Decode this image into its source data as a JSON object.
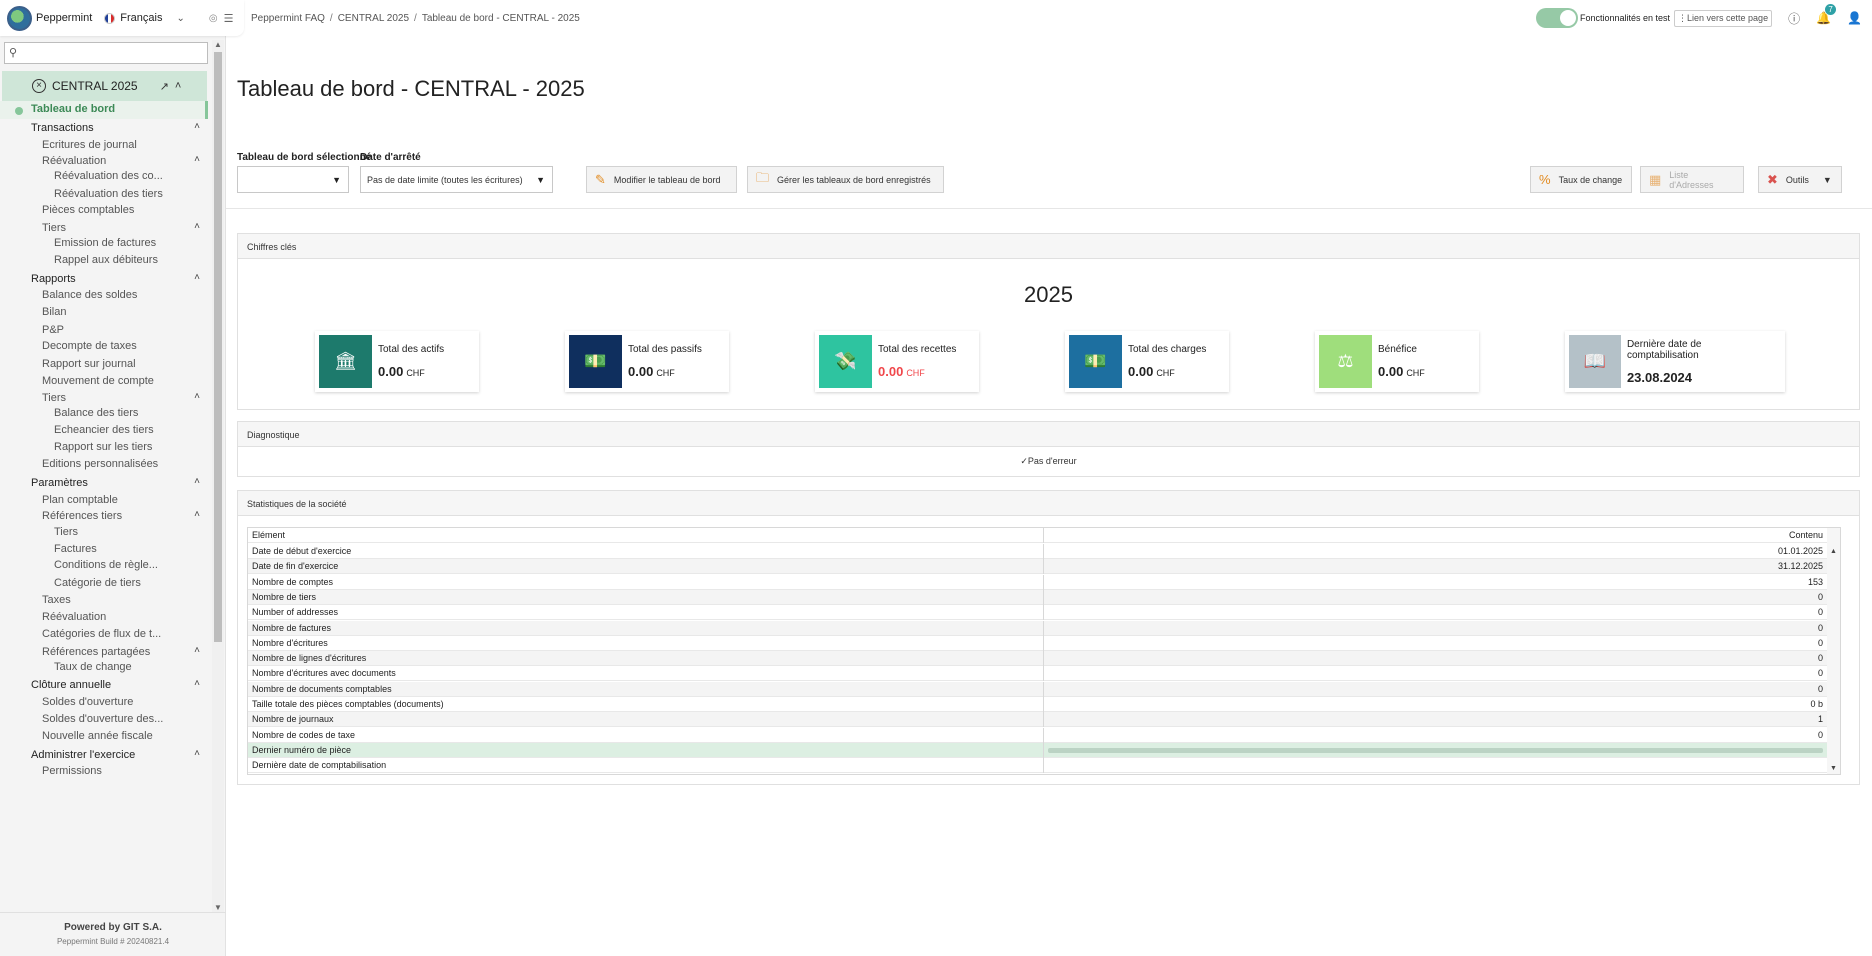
{
  "app": {
    "name": "Peppermint",
    "language": "Français"
  },
  "search": {
    "placeholder": ""
  },
  "company": {
    "label": "CENTRAL 2025"
  },
  "nav": [
    {
      "label": "Tableau de bord",
      "level": 1,
      "active": true
    },
    {
      "label": "Transactions",
      "level": 1,
      "section": true,
      "caret": "up"
    },
    {
      "label": "Ecritures de journal",
      "level": 2
    },
    {
      "label": "Réévaluation",
      "level": 2,
      "caret": "up"
    },
    {
      "label": "Réévaluation des co...",
      "level": 3
    },
    {
      "label": "Réévaluation des tiers",
      "level": 3
    },
    {
      "label": "Pièces comptables",
      "level": 2
    },
    {
      "label": "Tiers",
      "level": 2,
      "caret": "up"
    },
    {
      "label": "Emission de factures",
      "level": 3
    },
    {
      "label": "Rappel aux débiteurs",
      "level": 3
    },
    {
      "label": "Rapports",
      "level": 1,
      "section": true,
      "caret": "up"
    },
    {
      "label": "Balance des soldes",
      "level": 2
    },
    {
      "label": "Bilan",
      "level": 2
    },
    {
      "label": "P&P",
      "level": 2
    },
    {
      "label": "Decompte de taxes",
      "level": 2
    },
    {
      "label": "Rapport sur journal",
      "level": 2
    },
    {
      "label": "Mouvement de compte",
      "level": 2
    },
    {
      "label": "Tiers",
      "level": 2,
      "caret": "up"
    },
    {
      "label": "Balance des tiers",
      "level": 3
    },
    {
      "label": "Echeancier des tiers",
      "level": 3
    },
    {
      "label": "Rapport sur les tiers",
      "level": 3
    },
    {
      "label": "Editions personnalisées",
      "level": 2
    },
    {
      "label": "Paramètres",
      "level": 1,
      "section": true,
      "caret": "up"
    },
    {
      "label": "Plan comptable",
      "level": 2
    },
    {
      "label": "Références tiers",
      "level": 2,
      "caret": "up"
    },
    {
      "label": "Tiers",
      "level": 3
    },
    {
      "label": "Factures",
      "level": 3
    },
    {
      "label": "Conditions de règle...",
      "level": 3
    },
    {
      "label": "Catégorie de tiers",
      "level": 3
    },
    {
      "label": "Taxes",
      "level": 2
    },
    {
      "label": "Réévaluation",
      "level": 2
    },
    {
      "label": "Catégories de flux de t...",
      "level": 2
    },
    {
      "label": "Références partagées",
      "level": 2,
      "caret": "up"
    },
    {
      "label": "Taux de change",
      "level": 3
    },
    {
      "label": "Clôture annuelle",
      "level": 1,
      "section": true,
      "caret": "up"
    },
    {
      "label": "Soldes d'ouverture",
      "level": 2
    },
    {
      "label": "Soldes d'ouverture des...",
      "level": 2
    },
    {
      "label": "Nouvelle année fiscale",
      "level": 2
    },
    {
      "label": "Administrer l'exercice",
      "level": 1,
      "section": true,
      "caret": "up"
    },
    {
      "label": "Permissions",
      "level": 2
    }
  ],
  "footer": {
    "powered": "Powered by GIT S.A.",
    "build": "Peppermint Build # 20240821.4"
  },
  "breadcrumb": [
    "Peppermint FAQ",
    "CENTRAL 2025",
    "Tableau de bord - CENTRAL - 2025"
  ],
  "topbar": {
    "toggle_label": "Fonctionnalités en test",
    "page_link": "Lien vers cette page",
    "notifications_count": "7"
  },
  "page": {
    "title": "Tableau de bord - CENTRAL - 2025"
  },
  "filters": {
    "dashboard_label": "Tableau de bord sélectionné",
    "dashboard_value": "",
    "date_label": "Date d'arrêté",
    "date_value": "Pas de date limite (toutes les écritures)"
  },
  "buttons": {
    "edit_dashboard": "Modifier le tableau de bord",
    "manage_dashboards": "Gérer les tableaux de bord enregistrés",
    "exchange_rates": "Taux de change",
    "address_list": "Liste d'Adresses",
    "tools": "Outils"
  },
  "key_figures": {
    "header": "Chiffres clés",
    "year": "2025",
    "cards": [
      {
        "label": "Total des actifs",
        "value": "0.00",
        "currency": "CHF",
        "color": "#1d7a6c",
        "icon": "bank-icon",
        "negative": false
      },
      {
        "label": "Total des passifs",
        "value": "0.00",
        "currency": "CHF",
        "color": "#0f2f5e",
        "icon": "money-icon",
        "negative": false
      },
      {
        "label": "Total des recettes",
        "value": "0.00",
        "currency": "CHF",
        "color": "#2ec4a0",
        "icon": "money-hand-icon",
        "negative": true
      },
      {
        "label": "Total des charges",
        "value": "0.00",
        "currency": "CHF",
        "color": "#1d6fa0",
        "icon": "money-icon",
        "negative": false
      },
      {
        "label": "Bénéfice",
        "value": "0.00",
        "currency": "CHF",
        "color": "#9fde7c",
        "icon": "scale-icon",
        "negative": false
      },
      {
        "label": "Dernière date de comptabilisation",
        "value": "23.08.2024",
        "currency": "",
        "color": "#b4c1c8",
        "icon": "book-icon",
        "negative": false
      }
    ]
  },
  "diagnostics": {
    "header": "Diagnostique",
    "status": "Pas d'erreur"
  },
  "stats": {
    "header": "Statistiques de la société",
    "col_element": "Elément",
    "col_content": "Contenu",
    "rows": [
      {
        "label": "Date de début d'exercice",
        "value": "01.01.2025"
      },
      {
        "label": "Date de fin d'exercice",
        "value": "31.12.2025"
      },
      {
        "label": "Nombre de comptes",
        "value": "153"
      },
      {
        "label": "Nombre de tiers",
        "value": "0"
      },
      {
        "label": "Number of addresses",
        "value": "0"
      },
      {
        "label": "Nombre de factures",
        "value": "0"
      },
      {
        "label": "Nombre d'écritures",
        "value": "0"
      },
      {
        "label": "Nombre de lignes d'écritures",
        "value": "0"
      },
      {
        "label": "Nombre d'écritures avec documents",
        "value": "0"
      },
      {
        "label": "Nombre de documents comptables",
        "value": "0"
      },
      {
        "label": "Taille totale des pièces comptables (documents)",
        "value": "0 b"
      },
      {
        "label": "Nombre de journaux",
        "value": "1"
      },
      {
        "label": "Nombre de codes de taxe",
        "value": "0"
      },
      {
        "label": "Dernier numéro de pièce",
        "value": "",
        "loading": true
      },
      {
        "label": "Dernière date de comptabilisation",
        "value": ""
      }
    ]
  }
}
